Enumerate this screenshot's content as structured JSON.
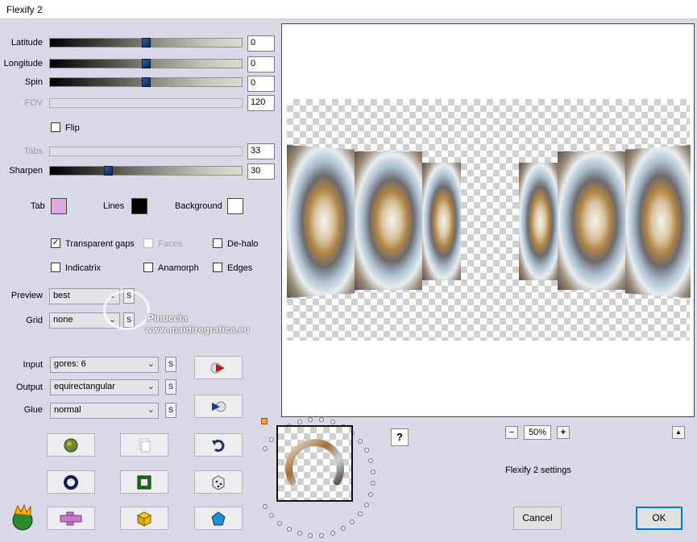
{
  "window": {
    "title": "Flexify 2"
  },
  "sliders": [
    {
      "label": "Latitude",
      "value": "0",
      "level": 0.5,
      "enabled": true
    },
    {
      "label": "Longitude",
      "value": "0",
      "level": 0.5,
      "enabled": true
    },
    {
      "label": "Spin",
      "value": "0",
      "level": 0.5,
      "enabled": true
    },
    {
      "label": "FOV",
      "value": "120",
      "enabled": false
    },
    {
      "label": "Tabs",
      "value": "33",
      "enabled": false
    },
    {
      "label": "Sharpen",
      "value": "30",
      "level": 0.3,
      "enabled": true
    }
  ],
  "flip": {
    "label": "Flip",
    "checked": false
  },
  "colors": {
    "tab": {
      "label": "Tab",
      "color": "#dba9dd"
    },
    "lines": {
      "label": "Lines",
      "color": "#000000"
    },
    "background": {
      "label": "Background",
      "color": "#ffffff"
    }
  },
  "options": [
    {
      "label": "Transparent gaps",
      "checked": true,
      "enabled": true
    },
    {
      "label": "Faces",
      "checked": false,
      "enabled": false
    },
    {
      "label": "De-halo",
      "checked": false,
      "enabled": true
    },
    {
      "label": "Indicatrix",
      "checked": false,
      "enabled": true
    },
    {
      "label": "Anamorph",
      "checked": false,
      "enabled": true
    },
    {
      "label": "Edges",
      "checked": false,
      "enabled": true
    }
  ],
  "preview_select": {
    "label": "Preview",
    "value": "best"
  },
  "grid_select": {
    "label": "Grid",
    "value": "none"
  },
  "input_select": {
    "label": "Input",
    "value": "gores: 6"
  },
  "output_select": {
    "label": "Output",
    "value": "equirectangular"
  },
  "glue_select": {
    "label": "Glue",
    "value": "normal"
  },
  "s_button": "S",
  "watermark": {
    "name": "Pinuccia",
    "site": "www.maidiregrafica.eu"
  },
  "zoom": {
    "minus": "−",
    "value": "50%",
    "plus": "+"
  },
  "help": "?",
  "up": "▲",
  "settings_label": "Flexify 2 settings",
  "buttons": {
    "cancel": "Cancel",
    "ok": "OK"
  },
  "icons": {
    "play": "play-icon",
    "play_back": "play-back-icon",
    "globe": "globe-icon",
    "pages": "pages-icon",
    "undo": "undo-icon",
    "ring": "ring-icon",
    "frame": "frame-icon",
    "dice": "dice-icon",
    "cross": "cross-icon",
    "cube": "cube-icon",
    "pentagon": "pentagon-icon",
    "logo": "flexify-logo-icon"
  }
}
